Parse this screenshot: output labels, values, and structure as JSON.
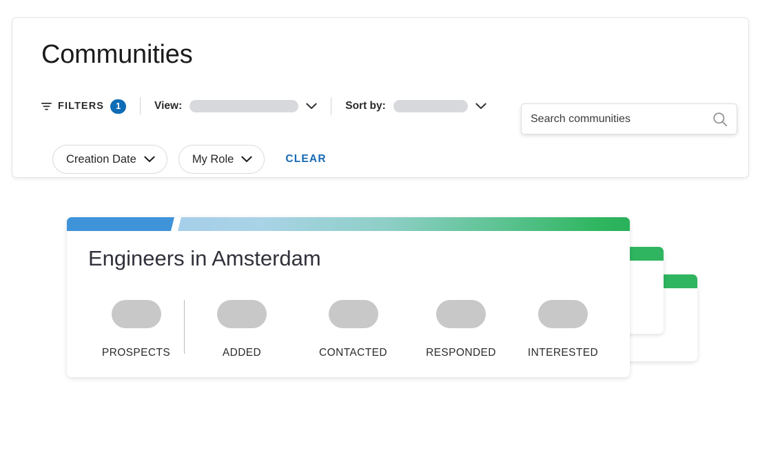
{
  "page": {
    "title": "Communities"
  },
  "toolbar": {
    "filters_label": "FILTERS",
    "filters_badge": "1",
    "filters_icon": "funnel-icon",
    "view_label": "View:",
    "view_value": "",
    "sort_label": "Sort by:",
    "sort_value": "",
    "chevron_icon": "chevron-down-icon",
    "search_placeholder": "Search communities",
    "search_value": "",
    "search_icon": "search-icon"
  },
  "chips": [
    {
      "label": "Creation Date",
      "icon": "chevron-down-icon"
    },
    {
      "label": "My Role",
      "icon": "chevron-down-icon"
    }
  ],
  "clear": {
    "label": "CLEAR"
  },
  "community_card": {
    "title": "Engineers in Amsterdam",
    "stats": [
      {
        "label": "PROSPECTS",
        "value": ""
      },
      {
        "label": "ADDED",
        "value": ""
      },
      {
        "label": "CONTACTED",
        "value": ""
      },
      {
        "label": "RESPONDED",
        "value": ""
      },
      {
        "label": "INTERESTED",
        "value": ""
      }
    ]
  },
  "colors": {
    "accent_blue": "#0f6cb6",
    "link_blue": "#1669b5",
    "bar_blue": "#3f93d9",
    "bar_green": "#2fb45f",
    "skeleton_gray": "#c8c8c8",
    "panel_border": "#e2e4e7"
  }
}
